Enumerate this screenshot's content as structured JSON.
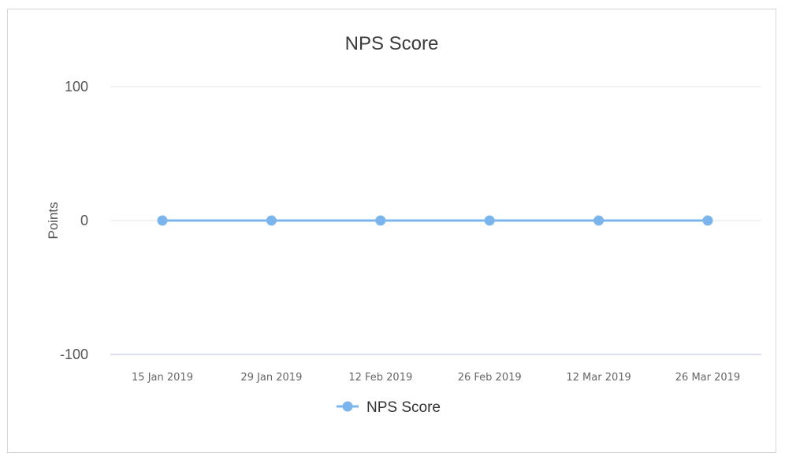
{
  "chart_data": {
    "type": "line",
    "title": "NPS Score",
    "xlabel": "",
    "ylabel": "Points",
    "ylim": [
      -100,
      100
    ],
    "yticks": [
      "100",
      "0",
      "-100"
    ],
    "categories": [
      "15 Jan 2019",
      "29 Jan 2019",
      "12 Feb 2019",
      "26 Feb 2019",
      "12 Mar 2019",
      "26 Mar 2019"
    ],
    "series": [
      {
        "name": "NPS Score",
        "values": [
          0,
          0,
          0,
          0,
          0,
          0
        ],
        "color": "#7cb5ec"
      }
    ],
    "grid": true,
    "legend": "bottom-center"
  }
}
